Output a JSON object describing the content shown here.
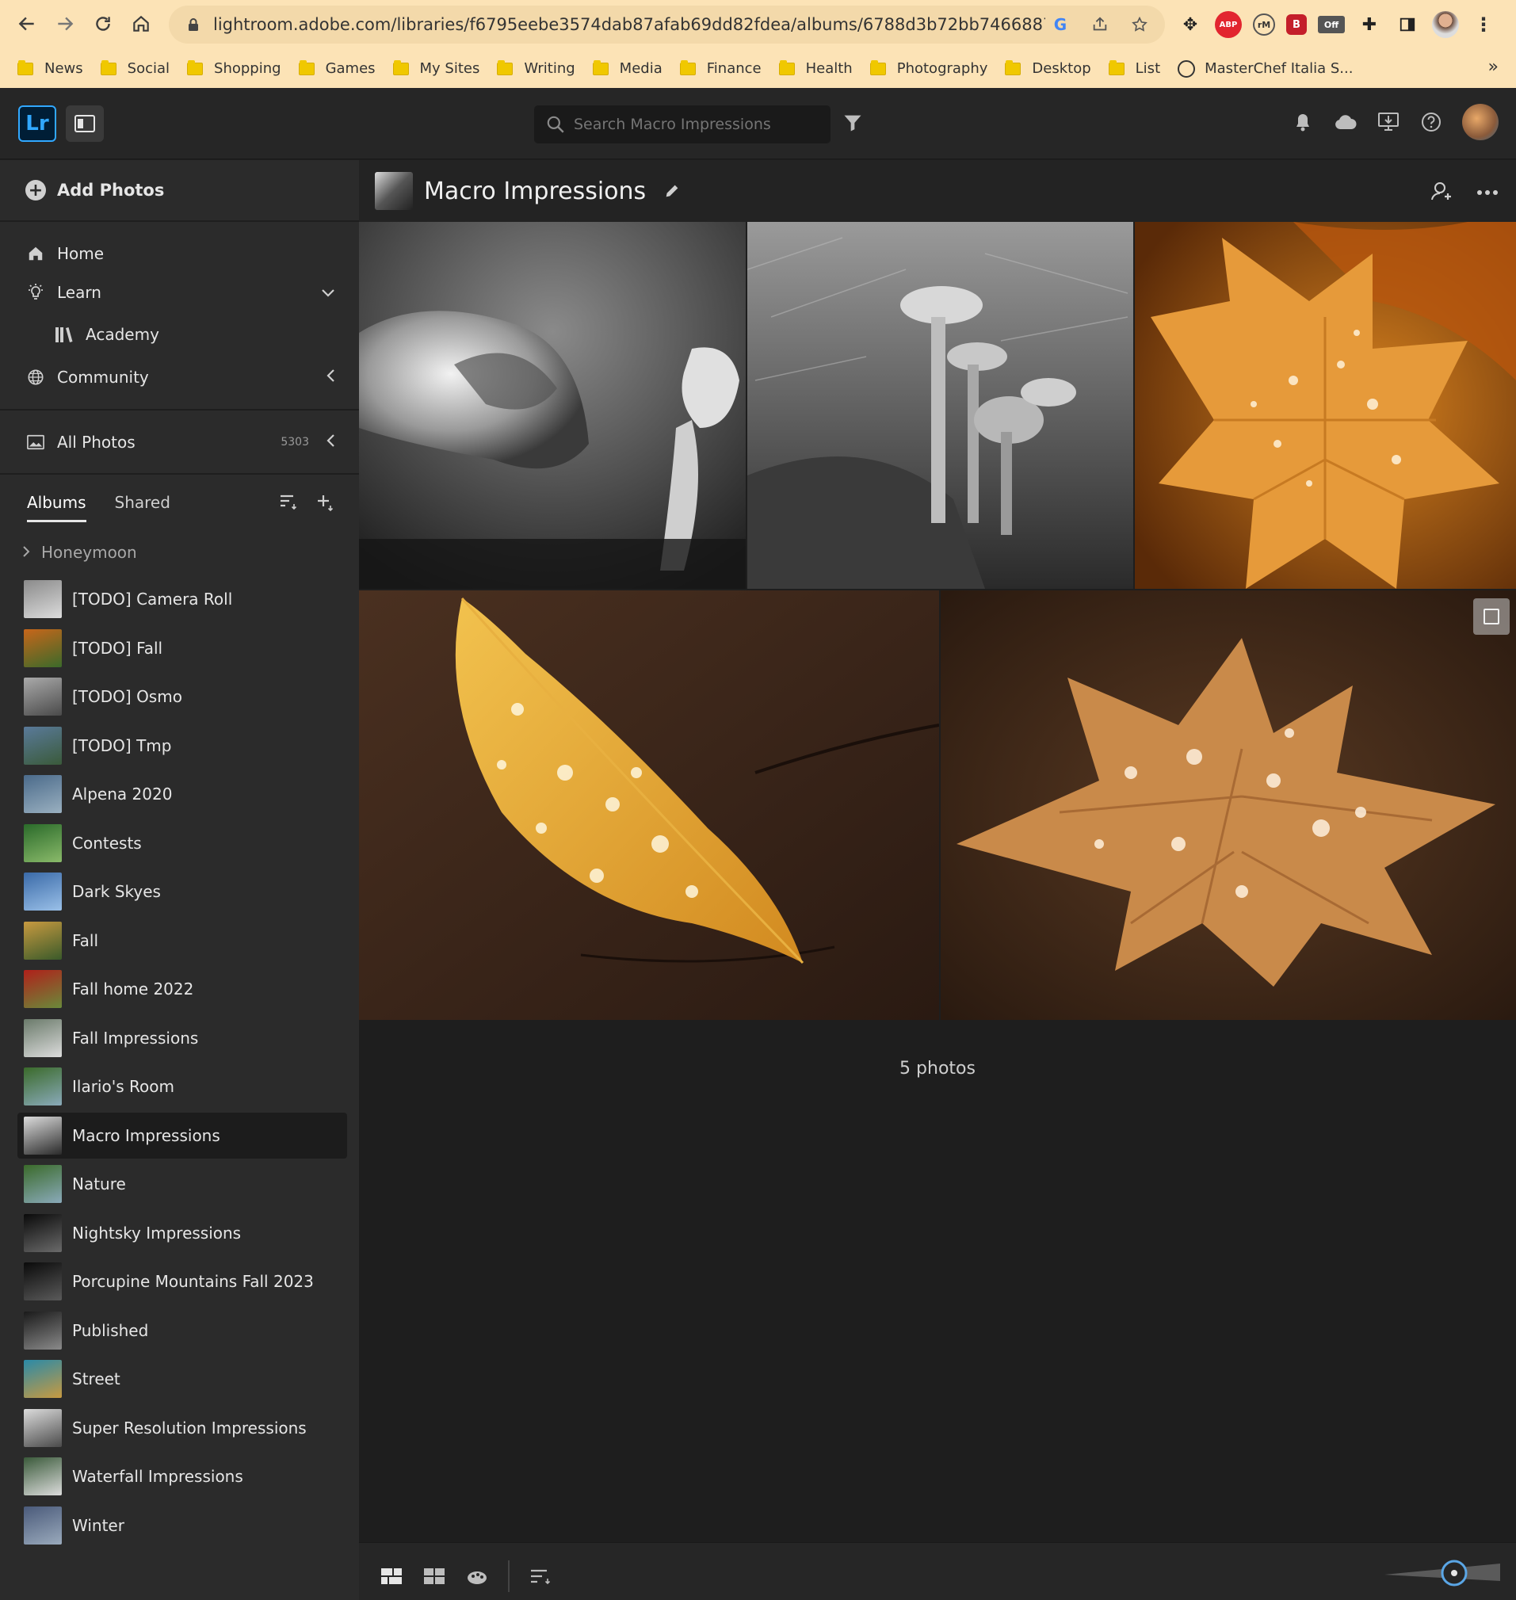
{
  "browser": {
    "url": "lightroom.adobe.com/libraries/f6795eebe3574dab87afab69dd82fdea/albums/6788d3b72bb746688749383c66e...",
    "bookmarks": [
      "News",
      "Social",
      "Shopping",
      "Games",
      "My Sites",
      "Writing",
      "Media",
      "Finance",
      "Health",
      "Photography",
      "Desktop",
      "List"
    ],
    "bookmark_site": "MasterChef Italia S...",
    "ext_abp": "ABP",
    "ext_m": "rM",
    "ext_b": "B",
    "ext_off": "Off",
    "more": "»"
  },
  "app": {
    "logo": "Lr",
    "search_placeholder": "Search Macro Impressions",
    "accent": "#31a8ff"
  },
  "sidebar": {
    "add_photos": "Add Photos",
    "home": "Home",
    "learn": "Learn",
    "academy": "Academy",
    "community": "Community",
    "all_photos": "All Photos",
    "all_photos_count": "5303",
    "tab_albums": "Albums",
    "tab_shared": "Shared",
    "group": "Honeymoon",
    "albums": [
      {
        "label": "[TODO] Camera Roll",
        "icon": "album-thumb"
      },
      {
        "label": "[TODO] Fall",
        "icon": "album-thumb"
      },
      {
        "label": "[TODO] Osmo",
        "icon": "album-thumb"
      },
      {
        "label": "[TODO] Tmp",
        "icon": "album-thumb"
      },
      {
        "label": "Alpena 2020",
        "icon": "album-thumb"
      },
      {
        "label": "Contests",
        "icon": "album-thumb"
      },
      {
        "label": "Dark Skyes",
        "icon": "album-thumb"
      },
      {
        "label": "Fall",
        "icon": "album-thumb"
      },
      {
        "label": "Fall home 2022",
        "icon": "album-thumb"
      },
      {
        "label": "Fall Impressions",
        "icon": "album-thumb"
      },
      {
        "label": "Ilario's Room",
        "icon": "album-thumb"
      },
      {
        "label": "Macro Impressions",
        "icon": "album-thumb"
      },
      {
        "label": "Nature",
        "icon": "album-thumb"
      },
      {
        "label": "Nightsky Impressions",
        "icon": "album-thumb"
      },
      {
        "label": "Porcupine Mountains Fall 2023",
        "icon": "album-thumb"
      },
      {
        "label": "Published",
        "icon": "album-thumb"
      },
      {
        "label": "Street",
        "icon": "album-thumb"
      },
      {
        "label": "Super Resolution Impressions",
        "icon": "album-thumb"
      },
      {
        "label": "Waterfall Impressions",
        "icon": "album-thumb"
      },
      {
        "label": "Winter",
        "icon": "album-thumb"
      }
    ],
    "selected_album": "Macro Impressions"
  },
  "main": {
    "album_title": "Macro Impressions",
    "photo_count": "5 photos"
  }
}
